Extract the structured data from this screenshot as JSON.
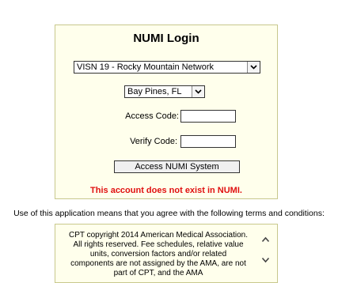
{
  "login": {
    "title": "NUMI Login",
    "network_select": {
      "selected": "VISN 19 - Rocky Mountain Network"
    },
    "location_select": {
      "selected": "Bay Pines, FL"
    },
    "access_code": {
      "label": "Access Code:",
      "value": ""
    },
    "verify_code": {
      "label": "Verify Code:",
      "value": ""
    },
    "submit_label": "Access NUMI System",
    "error_message": "This account does not exist in NUMI."
  },
  "terms": {
    "intro": "Use of this application means that you agree with the following terms and conditions:",
    "text": "CPT copyright 2014 American Medical Association. All rights reserved. Fee schedules, relative value units, conversion factors and/or related components are not assigned by the AMA, are not part of CPT, and the AMA"
  },
  "icons": {
    "dropdown": "chevron-down-icon",
    "scroll_up": "chevron-up-icon",
    "scroll_down": "chevron-down-icon"
  },
  "colors": {
    "panel_bg": "#ffffec",
    "panel_border": "#c8c88c",
    "error": "#e01010"
  }
}
